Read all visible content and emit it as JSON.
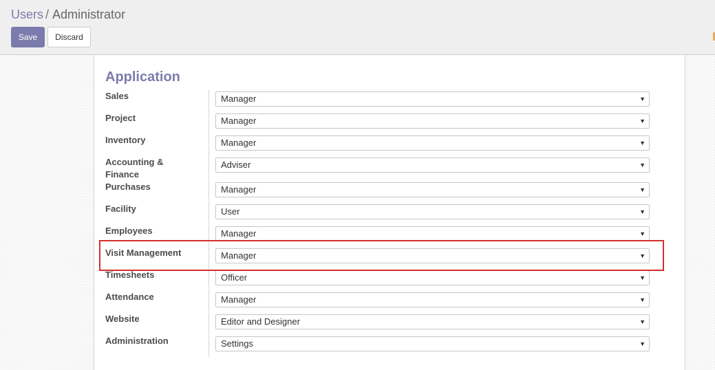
{
  "breadcrumb": {
    "parent": "Users",
    "separator": "/",
    "current": "Administrator"
  },
  "buttons": {
    "save_label": "Save",
    "discard_label": "Discard"
  },
  "section": {
    "title": "Application"
  },
  "rows": [
    {
      "label": "Sales",
      "value": "Manager"
    },
    {
      "label": "Project",
      "value": "Manager"
    },
    {
      "label": "Inventory",
      "value": "Manager"
    },
    {
      "label": "Accounting & Finance",
      "value": "Adviser"
    },
    {
      "label": "Purchases",
      "value": "Manager"
    },
    {
      "label": "Facility",
      "value": "User"
    },
    {
      "label": "Employees",
      "value": "Manager"
    },
    {
      "label": "Visit Management",
      "value": "Manager"
    },
    {
      "label": "Timesheets",
      "value": "Officer"
    },
    {
      "label": "Attendance",
      "value": "Manager"
    },
    {
      "label": "Website",
      "value": "Editor and Designer"
    },
    {
      "label": "Administration",
      "value": "Settings"
    }
  ],
  "icons": {
    "dropdown_caret": "caret-down-icon"
  },
  "colors": {
    "accent": "#7c7bad",
    "highlight": "#d32f2f"
  }
}
